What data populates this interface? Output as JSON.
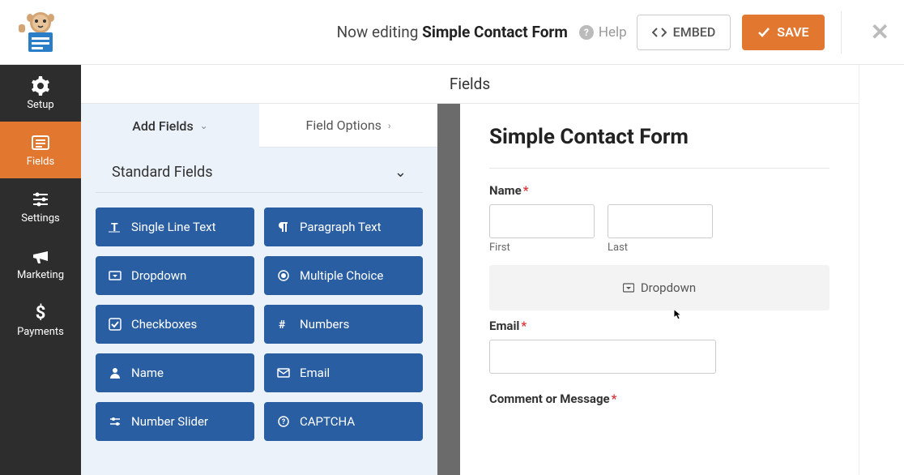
{
  "header": {
    "editing_prefix": "Now editing ",
    "form_name": "Simple Contact Form",
    "help": "Help",
    "embed": "EMBED",
    "save": "SAVE"
  },
  "sidebar": {
    "items": [
      {
        "label": "Setup"
      },
      {
        "label": "Fields"
      },
      {
        "label": "Settings"
      },
      {
        "label": "Marketing"
      },
      {
        "label": "Payments"
      }
    ]
  },
  "section_title": "Fields",
  "tabs": {
    "add": "Add Fields",
    "options": "Field Options"
  },
  "standard_heading": "Standard Fields",
  "field_buttons": [
    {
      "label": "Single Line Text",
      "icon": "text"
    },
    {
      "label": "Paragraph Text",
      "icon": "para"
    },
    {
      "label": "Dropdown",
      "icon": "drop"
    },
    {
      "label": "Multiple Choice",
      "icon": "radio"
    },
    {
      "label": "Checkboxes",
      "icon": "check"
    },
    {
      "label": "Numbers",
      "icon": "hash"
    },
    {
      "label": "Name",
      "icon": "user"
    },
    {
      "label": "Email",
      "icon": "mail"
    },
    {
      "label": "Number Slider",
      "icon": "slider"
    },
    {
      "label": "CAPTCHA",
      "icon": "captcha"
    }
  ],
  "preview": {
    "title": "Simple Contact Form",
    "name_label": "Name",
    "first": "First",
    "last": "Last",
    "drop_label": "Dropdown",
    "email_label": "Email",
    "comment_label": "Comment or Message"
  }
}
